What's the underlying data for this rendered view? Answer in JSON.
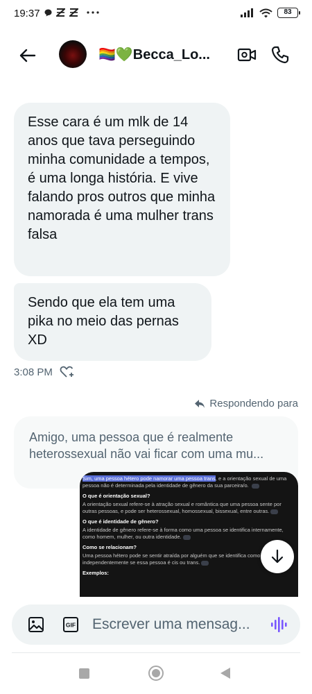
{
  "status_bar": {
    "time": "19:37",
    "battery": "83",
    "icons": [
      "chat-bubble-icon",
      "notification-icon",
      "notification-icon",
      "more-dots-icon",
      "signal-icon",
      "wifi-icon",
      "battery-icon"
    ]
  },
  "header": {
    "contact_name": "🏳️‍🌈💚Becca_Lo...",
    "icons": [
      "back-arrow-icon",
      "avatar",
      "video-call-icon",
      "phone-call-icon"
    ]
  },
  "messages": [
    {
      "text": "Esse cara é um mlk de 14 anos que tava perseguindo minha comunidade a tempos, é uma longa história. E vive falando pros outros que minha namorada é uma mulher trans falsa"
    },
    {
      "text": "Sendo que ela tem uma pika no meio das pernas XD"
    }
  ],
  "message_meta": {
    "time": "3:08 PM",
    "reaction_icon": "add-reaction-heart-icon"
  },
  "reply": {
    "label": "Respondendo para",
    "quote_line1": "Amigo, uma pessoa que é realmente",
    "quote_line2": "heterossexual não vai ficar com uma mu..."
  },
  "attached_image": {
    "highlight": "Sim, uma pessoa hétero pode namorar uma pessoa trans",
    "intro_rest": ", e a orientação sexual de uma pessoa não é determinada pela identidade de gênero da sua parceira/o.",
    "h1": "O que é orientação sexual?",
    "p1": "A orientação sexual refere-se à atração sexual e romântica que uma pessoa sente por outras pessoas, e pode ser heterossexual, homossexual, bissexual, entre outras.",
    "h2": "O que é identidade de gênero?",
    "p2": "A identidade de gênero refere-se à forma como uma pessoa se identifica internamente, como homem, mulher, ou outra identidade.",
    "h3": "Como se relacionam?",
    "p3": "Uma pessoa hétero pode se sentir atraída por alguém que se identifica como mulher, independentemente se essa pessoa é cis ou trans.",
    "h4": "Exemplos:"
  },
  "composer": {
    "placeholder": "Escrever uma mensag...",
    "icons": [
      "image-icon",
      "gif-icon",
      "voice-message-icon"
    ],
    "accent_color": "#7856ff"
  },
  "nav_bar": {
    "icons": [
      "recents-square-icon",
      "home-circle-icon",
      "back-triangle-icon"
    ]
  }
}
